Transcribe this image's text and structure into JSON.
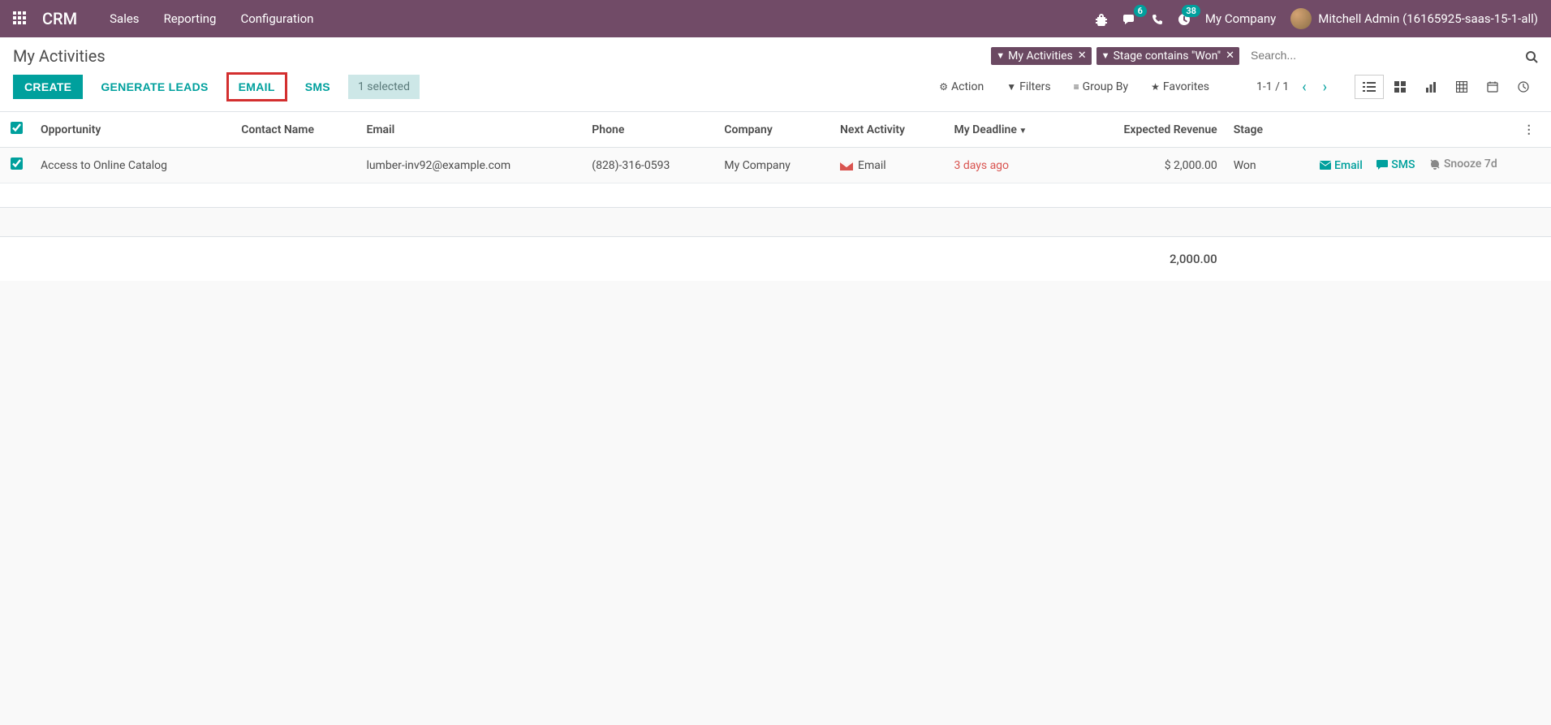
{
  "navbar": {
    "brand": "CRM",
    "menu": [
      "Sales",
      "Reporting",
      "Configuration"
    ],
    "msg_badge": "6",
    "clock_badge": "38",
    "company": "My Company",
    "user": "Mitchell Admin (16165925-saas-15-1-all)"
  },
  "page": {
    "title": "My Activities"
  },
  "search": {
    "filters": [
      {
        "label": "My Activities"
      },
      {
        "label": "Stage contains \"Won\""
      }
    ],
    "placeholder": "Search..."
  },
  "toolbar": {
    "create": "CREATE",
    "generate": "GENERATE LEADS",
    "email": "EMAIL",
    "sms": "SMS",
    "selected": "1 selected",
    "action": "Action",
    "filters": "Filters",
    "groupby": "Group By",
    "favorites": "Favorites",
    "pager": "1-1 / 1"
  },
  "columns": {
    "opportunity": "Opportunity",
    "contact": "Contact Name",
    "email": "Email",
    "phone": "Phone",
    "company": "Company",
    "next_activity": "Next Activity",
    "deadline": "My Deadline",
    "revenue": "Expected Revenue",
    "stage": "Stage"
  },
  "rows": [
    {
      "opportunity": "Access to Online Catalog",
      "contact": "",
      "email": "lumber-inv92@example.com",
      "phone": "(828)-316-0593",
      "company": "My Company",
      "next_activity": "Email",
      "deadline": "3 days ago",
      "revenue": "$ 2,000.00",
      "stage": "Won"
    }
  ],
  "row_actions": {
    "email": "Email",
    "sms": "SMS",
    "snooze": "Snooze 7d"
  },
  "totals": {
    "revenue": "2,000.00"
  }
}
